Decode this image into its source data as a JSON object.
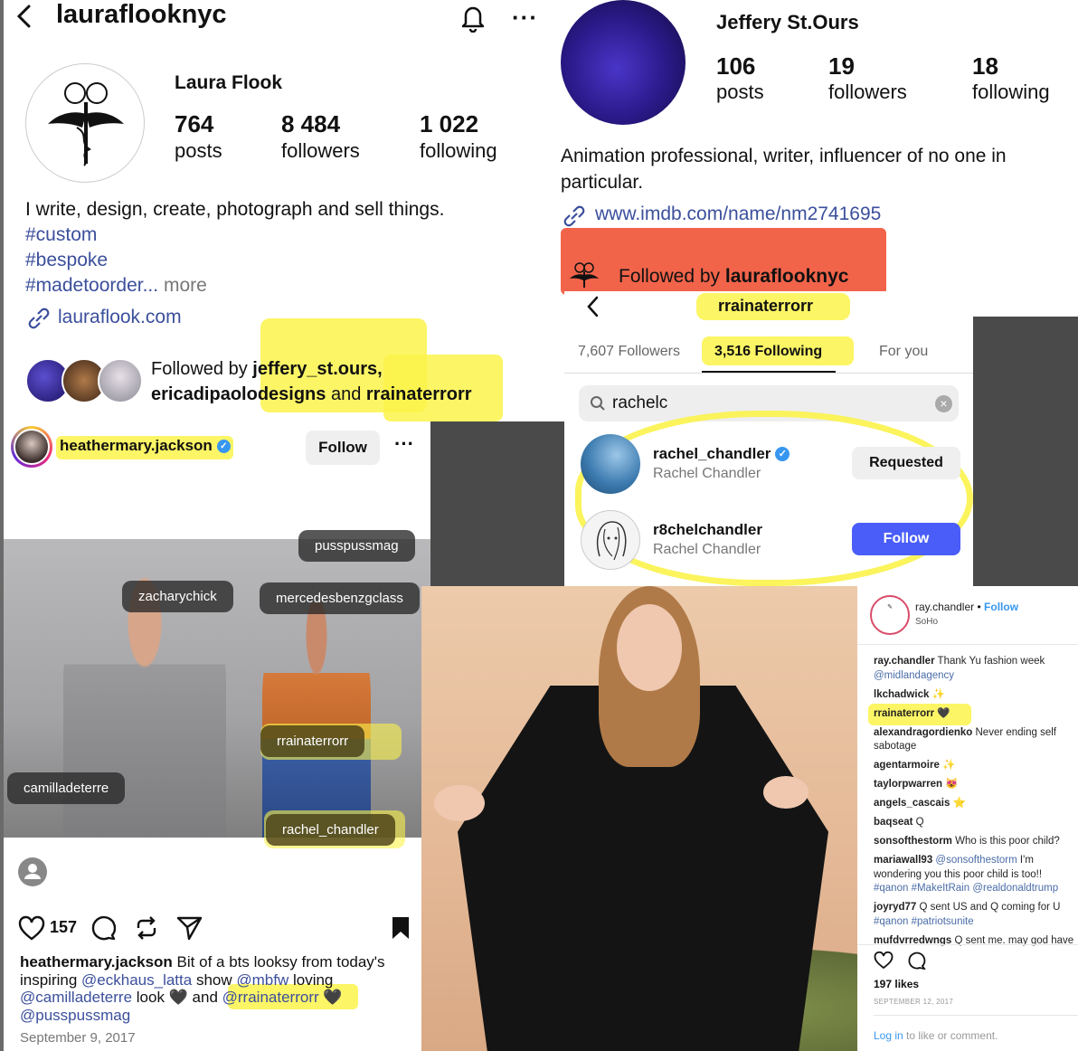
{
  "laura": {
    "username": "lauraflooknyc",
    "name": "Laura Flook",
    "stats": [
      {
        "num": "764",
        "label": "posts"
      },
      {
        "num": "8 484",
        "label": "followers"
      },
      {
        "num": "1 022",
        "label": "following"
      }
    ],
    "bio": "I write, design, create, photograph and sell things.",
    "hashtags": [
      "#custom",
      "#bespoke",
      "#madetoorder"
    ],
    "ellipsis": "...",
    "more": "more",
    "link": "lauraflook.com",
    "followed_prefix": "Followed by ",
    "followed_user1": "jeffery_st.ours,",
    "followed_user2": "ericadipaolodesigns",
    "followed_and": " and ",
    "followed_user3": "rrainaterrorr"
  },
  "jeffery": {
    "name": "Jeffery St.Ours",
    "stats": [
      {
        "num": "106",
        "label": "posts"
      },
      {
        "num": "19",
        "label": "followers"
      },
      {
        "num": "18",
        "label": "following"
      }
    ],
    "bio": "Animation professional, writer, influencer of no one in particular.",
    "link": "www.imdb.com/name/nm2741695",
    "followed_prefix": "Followed by ",
    "followed_user": "lauraflooknyc"
  },
  "following": {
    "title": "rrainaterrorr",
    "tabs": [
      "7,607 Followers",
      "3,516 Following",
      "For you"
    ],
    "search_value": "rachelc",
    "results": [
      {
        "username": "rachel_chandler",
        "name": "Rachel Chandler",
        "button": "Requested"
      },
      {
        "username": "r8chelchandler",
        "name": "Rachel Chandler",
        "button": "Follow"
      }
    ]
  },
  "post": {
    "username": "heathermary.jackson",
    "follow_label": "Follow",
    "tags": [
      "pusspussmag",
      "zacharychick",
      "mercedesbenzgclass",
      "rrainaterrorr",
      "camilladeterre",
      "rachel_chandler"
    ],
    "likes": "157",
    "caption_user": "heathermary.jackson",
    "caption": [
      {
        "t": " Bit of a bts looksy from today's inspiring ",
        "m": false
      },
      {
        "t": "@eckhaus_latta",
        "m": true
      },
      {
        "t": " show ",
        "m": false
      },
      {
        "t": "@mbfw",
        "m": true
      },
      {
        "t": " loving ",
        "m": false
      },
      {
        "t": "@camilladeterre",
        "m": true
      },
      {
        "t": " look 🖤 and ",
        "m": false
      },
      {
        "t": "@rrainaterrorr",
        "m": true
      },
      {
        "t": " 🖤 ",
        "m": false
      },
      {
        "t": "@pusspussmag",
        "m": true
      }
    ],
    "date": "September 9, 2017"
  },
  "ray": {
    "username": "ray.chandler",
    "dot": "•",
    "follow": "Follow",
    "location": "SoHo",
    "comments": [
      {
        "u": "ray.chandler",
        "t": "Thank Yu fashion week",
        "m": "@midlandagency"
      },
      {
        "u": "lkchadwick",
        "t": "✨",
        "m": ""
      },
      {
        "u": "rrainaterrorr",
        "t": "🖤",
        "m": ""
      },
      {
        "u": "alexandragordienko",
        "t": "Never ending self sabotage",
        "m": ""
      },
      {
        "u": "agentarmoire",
        "t": "✨",
        "m": ""
      },
      {
        "u": "taylorpwarren",
        "t": "😻",
        "m": ""
      },
      {
        "u": "angels_cascais",
        "t": "⭐",
        "m": ""
      },
      {
        "u": "baqseat",
        "t": "Q",
        "m": ""
      },
      {
        "u": "sonsofthestorm",
        "t": "Who is this poor child?",
        "m": ""
      },
      {
        "u": "mariawall93",
        "t": "I'm wondering you this poor child is too!!",
        "m": "@sonsofthestorm",
        "tags": "#qanon #MakeItRain @realdonaldtrump"
      },
      {
        "u": "joyryd77",
        "t": "Q sent US and Q coming for U",
        "m": "",
        "tags": "#qanon #patriotsunite"
      },
      {
        "u": "mufdvrredwngs",
        "t": "Q sent me. may god have",
        "m": ""
      }
    ],
    "likes": "197 likes",
    "date": "SEPTEMBER 12, 2017",
    "login": "Log in",
    "login_rest": " to like or comment."
  }
}
